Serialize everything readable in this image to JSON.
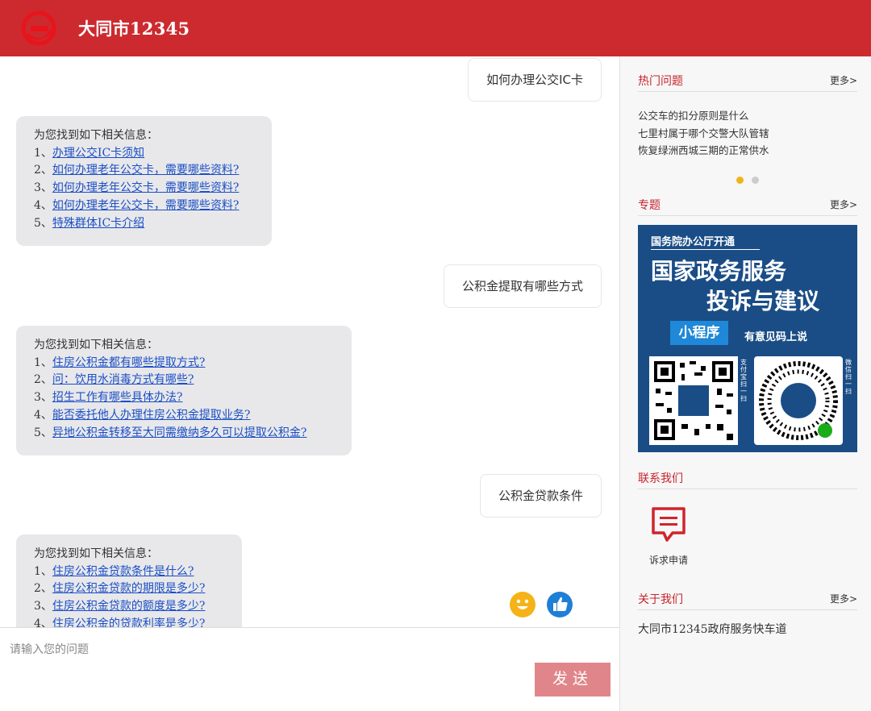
{
  "header": {
    "title": "大同市12345"
  },
  "chat": {
    "messages": [
      {
        "role": "user",
        "text": "如何办理公交IC卡"
      },
      {
        "role": "bot",
        "intro": "为您找到如下相关信息：",
        "items": [
          {
            "num": "1、",
            "text": "办理公交IC卡须知"
          },
          {
            "num": "2、",
            "text": "如何办理老年公交卡，需要哪些资料?"
          },
          {
            "num": "3、",
            "text": "如何办理老年公交卡，需要哪些资料?"
          },
          {
            "num": "4、",
            "text": "如何办理老年公交卡，需要哪些资料?"
          },
          {
            "num": "5、",
            "text": "特殊群体IC卡介绍"
          }
        ]
      },
      {
        "role": "user",
        "text": "公积金提取有哪些方式"
      },
      {
        "role": "bot",
        "intro": "为您找到如下相关信息：",
        "items": [
          {
            "num": "1、",
            "text": "住房公积金都有哪些提取方式?"
          },
          {
            "num": "2、",
            "text": "问：饮用水消毒方式有哪些?"
          },
          {
            "num": "3、",
            "text": "招生工作有哪些具体办法?"
          },
          {
            "num": "4、",
            "text": "能否委托他人办理住房公积金提取业务?"
          },
          {
            "num": "5、",
            "text": "异地公积金转移至大同需缴纳多久可以提取公积金?"
          }
        ]
      },
      {
        "role": "user",
        "text": "公积金贷款条件"
      },
      {
        "role": "bot",
        "intro": "为您找到如下相关信息：",
        "items": [
          {
            "num": "1、",
            "text": "住房公积金贷款条件是什么?"
          },
          {
            "num": "2、",
            "text": "住房公积金贷款的期限是多少?"
          },
          {
            "num": "3、",
            "text": "住房公积金贷款的额度是多少?"
          },
          {
            "num": "4、",
            "text": "住房公积金的贷款利率是多少?"
          }
        ]
      }
    ]
  },
  "input": {
    "placeholder": "请输入您的问题",
    "send_label": "发送"
  },
  "sidebar": {
    "hot": {
      "title": "热门问题",
      "more": "更多>",
      "items": [
        "公交车的扣分原则是什么",
        "七里村属于哪个交警大队管辖",
        "恢复绿洲西城三期的正常供水"
      ],
      "carousel": {
        "count": 2,
        "active": 0,
        "active_color": "#f0b418",
        "inactive_color": "#cccccc"
      }
    },
    "topics": {
      "title": "专题",
      "more": "更多>",
      "banner": {
        "line1": "国务院办公厅开通",
        "line2": "国家政务服务",
        "line3": "投诉与建议",
        "badge": "小程序",
        "opinion": "有意见码上说",
        "qr_left_label": "政务服务投诉",
        "qr_left_caption": "支付宝扫一扫",
        "qr_right_label": "政务服务投诉",
        "qr_right_caption": "微信扫一扫"
      }
    },
    "contact": {
      "title": "联系我们",
      "item_label": "诉求申请"
    },
    "about": {
      "title": "关于我们",
      "more": "更多>",
      "text": "大同市12345政府服务快车道"
    }
  },
  "colors": {
    "header": "#cc2a2f",
    "accent": "#c8242b",
    "link": "#1a4ec6",
    "send": "#e0868a"
  }
}
